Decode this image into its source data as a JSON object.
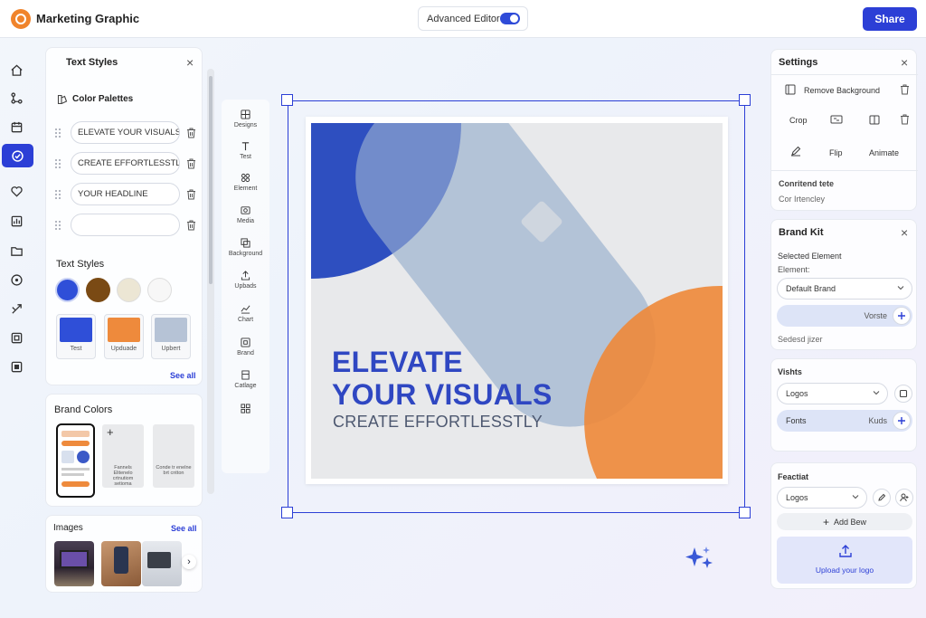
{
  "header": {
    "app_title": "Marketing Graphic",
    "advanced_editor_label": "Advanced Editor",
    "advanced_editor_on": true,
    "share_label": "Share"
  },
  "rail": {
    "icons": [
      "home-icon",
      "nodes-icon",
      "calendar-icon",
      "check-circle-icon",
      "tag-heart-icon",
      "chart-icon",
      "folder-icon",
      "info-circle-icon",
      "share-icon",
      "frame-icon",
      "frame-square-icon"
    ],
    "active_index": 3
  },
  "text_styles_panel": {
    "title": "Text Styles",
    "palettes_label": "Color Palettes",
    "palette_items": [
      "ELEVATE YOUR VISUALS",
      "CREATE EFFORTLESSTLY",
      "YOUR HEADLINE",
      ""
    ],
    "text_styles_label": "Text Styles",
    "swatch_colors": [
      "#2f4fd8",
      "#7a4a14",
      "#ece6d4",
      "#f7f7f7"
    ],
    "style_cards": [
      {
        "label": "Test",
        "color": "#2f4fd8"
      },
      {
        "label": "Upduade",
        "color": "#ee8a3c"
      },
      {
        "label": "Upbert",
        "color": "#b6c3d6"
      }
    ],
    "see_all": "See all"
  },
  "brand_colors_panel": {
    "title": "Brand Colors",
    "cards": [
      "Fannels Elitenelo\ncrtnutiom setioma",
      "Conde tr enelne\nbrt cntton"
    ]
  },
  "images_panel": {
    "title": "Images",
    "see_all": "See all"
  },
  "tools": [
    "Designs",
    "Test",
    "Element",
    "Media",
    "Background",
    "Upbads",
    "Chart",
    "Brand",
    "Catlage",
    ""
  ],
  "canvas": {
    "headline_line1": "ELEVATE",
    "headline_line2": "YOUR VISUALS",
    "subhead": "CREATE EFFORTLESSTLY",
    "colors": {
      "blue": "#2f4fc0",
      "orange": "#ee8a3c",
      "pill": "#a9bcd3"
    }
  },
  "settings_panel": {
    "title": "Settings",
    "remove_background": "Remove Background",
    "crop": "Crop",
    "flip": "Flip",
    "animate": "Animate",
    "content_label": "Conritend tete",
    "content_sub": "Cor Irtencley"
  },
  "brand_kit_panel": {
    "title": "Brand Kit",
    "selected_element": "Selected Element",
    "element_label": "Element:",
    "dropdown_value": "Default Brand",
    "vorste_label": "Vorste",
    "footer_label": "Sedesd jizer"
  },
  "vishts_panel": {
    "title": "Vishts",
    "logos_value": "Logos",
    "fonts_label": "Fonts",
    "fonts_right": "Kuds"
  },
  "footer_panel": {
    "title": "Feactiat",
    "logos_value": "Logos",
    "add_new": "Add Bew",
    "upload_label": "Upload your logo"
  }
}
